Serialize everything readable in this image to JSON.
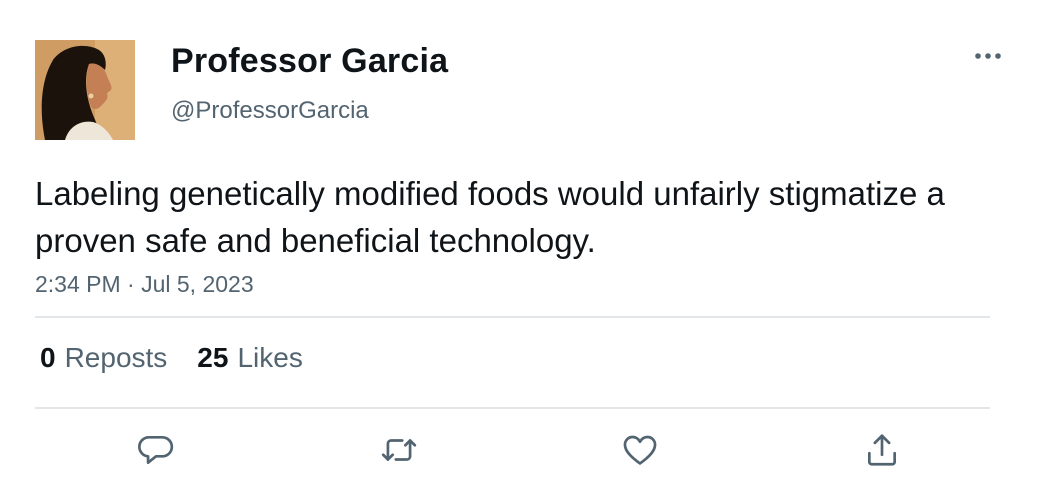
{
  "author": {
    "display_name": "Professor Garcia",
    "handle": "@ProfessorGarcia"
  },
  "tweet": {
    "text": "Labeling genetically modified foods would unfairly stigmatize a proven safe and beneficial technology.",
    "timestamp": "2:34 PM · Jul 5, 2023"
  },
  "stats": {
    "reposts_count": "0",
    "reposts_label": "Reposts",
    "likes_count": "25",
    "likes_label": "Likes"
  },
  "icons": {
    "more": "more-horizontal-icon",
    "reply": "reply-icon",
    "repost": "repost-icon",
    "like": "heart-icon",
    "share": "share-icon"
  },
  "colors": {
    "text_primary": "#0f1419",
    "text_secondary": "#536471",
    "divider": "#e3e6e8"
  }
}
